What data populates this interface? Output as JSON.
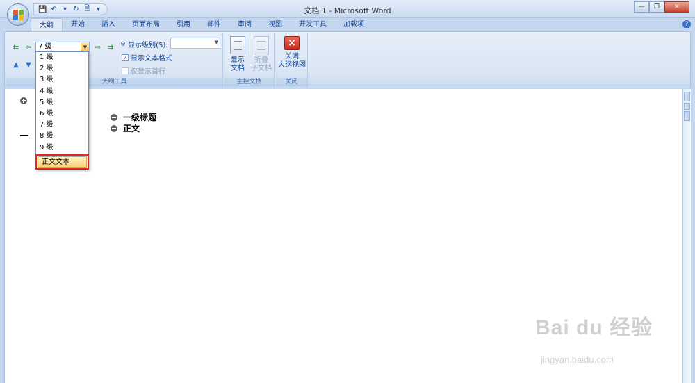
{
  "window": {
    "title": "文档 1 - Microsoft Word"
  },
  "tabs": [
    {
      "label": "大纲",
      "active": true
    },
    {
      "label": "开始"
    },
    {
      "label": "插入"
    },
    {
      "label": "页面布局"
    },
    {
      "label": "引用"
    },
    {
      "label": "邮件"
    },
    {
      "label": "审阅"
    },
    {
      "label": "视图"
    },
    {
      "label": "开发工具"
    },
    {
      "label": "加载项"
    }
  ],
  "outline_tools": {
    "level_value": "7 级",
    "show_level_label": "显示级别(S):",
    "show_text_format_label": "显示文本格式",
    "show_text_format_checked": true,
    "show_first_line_label": "仅显示首行",
    "show_first_line_checked": false,
    "group_label": "大纲工具"
  },
  "master_document": {
    "show_document_label": "显示\n文档",
    "show_document_l1": "显示",
    "show_document_l2": "文档",
    "collapse_l1": "折叠",
    "collapse_l2": "子文档",
    "group_label": "主控文档"
  },
  "close_group": {
    "close_l1": "关闭",
    "close_l2": "大纲视图",
    "group_label": "关闭"
  },
  "level_dropdown": {
    "items": [
      "1 级",
      "2 级",
      "3 级",
      "4 级",
      "5 级",
      "6 级",
      "7 级",
      "8 级",
      "9 级"
    ],
    "selected": "正文文本"
  },
  "document": {
    "lines": [
      {
        "text": "一级标题"
      },
      {
        "text": "正文"
      }
    ]
  },
  "watermark": {
    "brand": "Bai du 经验",
    "url": "jingyan.baidu.com"
  },
  "colors": {
    "accent": "#15428b",
    "highlight_border": "#e0242b",
    "selected_fill": "#fbd37a"
  }
}
